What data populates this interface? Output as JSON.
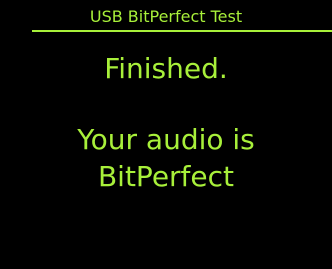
{
  "header": {
    "title": "USB BitPerfect Test"
  },
  "main": {
    "status": "Finished.",
    "result_line1": "Your audio is",
    "result_line2": "BitPerfect"
  },
  "colors": {
    "background": "#000000",
    "text": "#a8f03a"
  }
}
